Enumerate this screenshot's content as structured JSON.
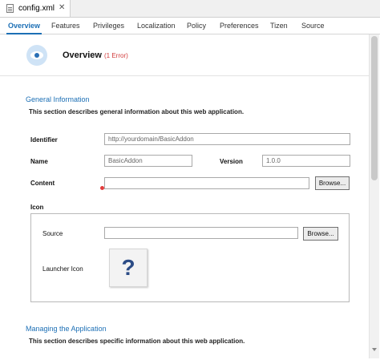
{
  "editor_tab": {
    "title": "config.xml",
    "close": "✕"
  },
  "page_tabs": [
    {
      "label": "Overview"
    },
    {
      "label": "Features"
    },
    {
      "label": "Privileges"
    },
    {
      "label": "Localization"
    },
    {
      "label": "Policy"
    },
    {
      "label": "Preferences"
    },
    {
      "label": "Tizen"
    },
    {
      "label": "Source"
    }
  ],
  "active_tab": "Overview",
  "header": {
    "title": "Overview",
    "error": "(1 Error)"
  },
  "general": {
    "heading": "General Information",
    "description": "This section describes general information about this web application.",
    "identifier_label": "Identifier",
    "identifier_value": "http://yourdomain/BasicAddon",
    "name_label": "Name",
    "name_value": "BasicAddon",
    "version_label": "Version",
    "version_value": "1.0.0",
    "content_label": "Content",
    "content_value": "",
    "browse_label": "Browse..."
  },
  "icon": {
    "heading": "Icon",
    "source_label": "Source",
    "source_value": "",
    "browse_label": "Browse...",
    "launcher_label": "Launcher Icon",
    "placeholder_glyph": "?"
  },
  "managing": {
    "heading": "Managing the Application",
    "description": "This section describes specific information about this web application."
  },
  "colors": {
    "accent": "#1c6fb5",
    "error": "#d23b3b"
  }
}
